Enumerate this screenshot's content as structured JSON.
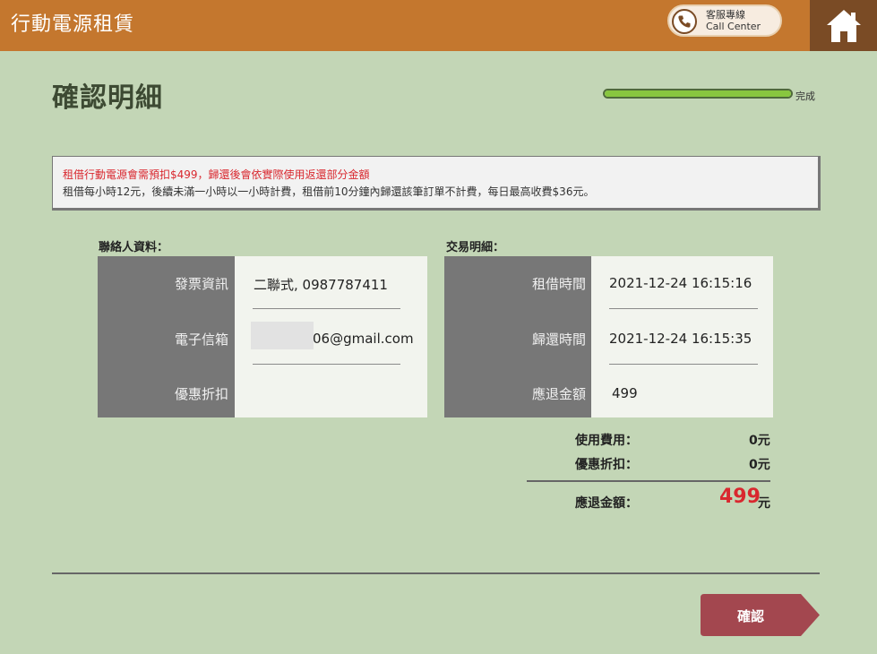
{
  "header": {
    "app_title": "行動電源租賃",
    "call_center": {
      "line1": "客服專線",
      "line2": "Call Center"
    },
    "home_icon": "home-icon"
  },
  "page": {
    "title": "確認明細",
    "progress": {
      "label": "完成",
      "percent": 100,
      "color": "#88c63f"
    }
  },
  "notice": {
    "warning": "租借行動電源會需預扣$499，歸還後會依實際使用返還部分金額",
    "info": "租借每小時12元，後續未滿一小時以一小時計費，租借前10分鐘內歸還該筆訂單不計費，每日最高收費$36元。"
  },
  "contact": {
    "heading": "聯絡人資料：",
    "rows": [
      {
        "label": "發票資訊",
        "value": "二聯式, 0987787411"
      },
      {
        "label": "電子信箱",
        "value": "06@gmail.com"
      },
      {
        "label": "優惠折扣",
        "value": ""
      }
    ]
  },
  "transaction": {
    "heading": "交易明細：",
    "rows": [
      {
        "label": "租借時間",
        "value": "2021-12-24 16:15:16"
      },
      {
        "label": "歸還時間",
        "value": "2021-12-24 16:15:35"
      },
      {
        "label": "應退金額",
        "value": "499"
      }
    ]
  },
  "summary": {
    "usage_label": "使用費用：",
    "usage_value": "0元",
    "discount_label": "優惠折扣：",
    "discount_value": "0元",
    "refund_label": "應退金額：",
    "refund_amount": "499",
    "refund_unit": "元",
    "accent_color": "#d9282f"
  },
  "actions": {
    "confirm_label": "確認"
  }
}
